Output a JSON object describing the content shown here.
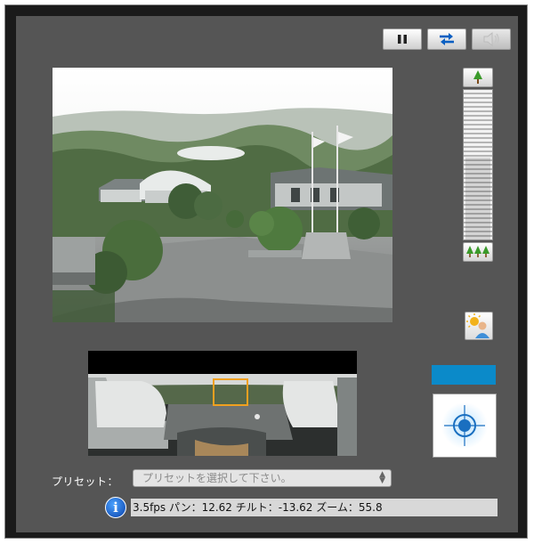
{
  "toolbar": {
    "buttons": [
      {
        "name": "pause",
        "icon": "pause-icon",
        "color": "#222222"
      },
      {
        "name": "refresh",
        "icon": "swap-arrows-icon",
        "color": "#0a5fc2"
      },
      {
        "name": "audio",
        "icon": "speaker-icon",
        "color": "#c8c8c8",
        "disabled": true
      }
    ]
  },
  "zoom": {
    "top_icon": "single-tree-icon",
    "bottom_icon": "three-trees-icon",
    "level": 0.55
  },
  "backlight": {
    "icon": "backlight-person-icon"
  },
  "panorama": {
    "icon": "panorama-view"
  },
  "ptz": {
    "accent": "#0b8ac9",
    "center_icon": "crosshair-target-icon"
  },
  "preset": {
    "label": "プリセット：",
    "placeholder": "プリセットを選択して下さい。"
  },
  "status": {
    "text": "3.5fps パン：12.62 チルト：-13.62 ズーム：55.8"
  }
}
